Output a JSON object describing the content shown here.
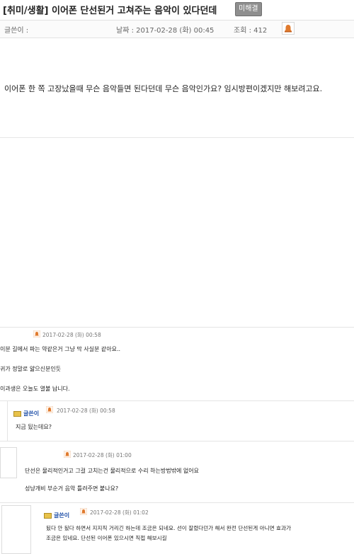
{
  "post": {
    "title": "[취미/생활] 이어폰 단선된거 고쳐주는 음악이 있다던데",
    "status_badge": "미해결",
    "author_label": "글쓴이 :",
    "date_label": "날짜 : 2017-02-28 (화) 00:45",
    "views_label": "조회 : 412",
    "body": "이어폰 한 쪽 고장났을때 무슨 음악들면 된다던데 무슨 음악인가요? 임시방편이겠지만 해보려고요."
  },
  "comments": [
    {
      "date": "2017-02-28 (화) 00:58",
      "lines": [
        "이분 길에서 파는 약같은거 그냥 막 사실분 같아요..",
        "귀가 정말로 얇으신분인듯",
        "이과생은 오늘도 열불 납니다."
      ]
    },
    {
      "author": "글쓴이",
      "date": "2017-02-28 (화) 00:58",
      "lines": [
        "지금 됬는데요?"
      ]
    },
    {
      "date": "2017-02-28 (화) 01:00",
      "lines": [
        "단선은 물리적인거고 그걸 고치는건 물리적으로 수리 하는방법밖에 없어요",
        "성냥개비 부순거 음악 틀려주면 붙나요?"
      ]
    },
    {
      "author": "글쓴이",
      "date": "2017-02-28 (화) 01:02",
      "lines": [
        "됬다 안 됬다 하면서 지지직 거리긴 하는데 조금은 되네요. 선이 잘렸다던가 해서 완전 단선된게 아니면 효과가",
        "조금은 있네요. 단선된 이어폰 있으시면 직접 해보시길"
      ]
    }
  ],
  "colors": {
    "badge_bg": "#8e8e8e",
    "author_name": "#1f4fa8",
    "bell": "#e07a2e"
  },
  "icons": {
    "report": "bell-icon",
    "comment": "bell-icon",
    "author_tag": "author-tag-icon"
  }
}
